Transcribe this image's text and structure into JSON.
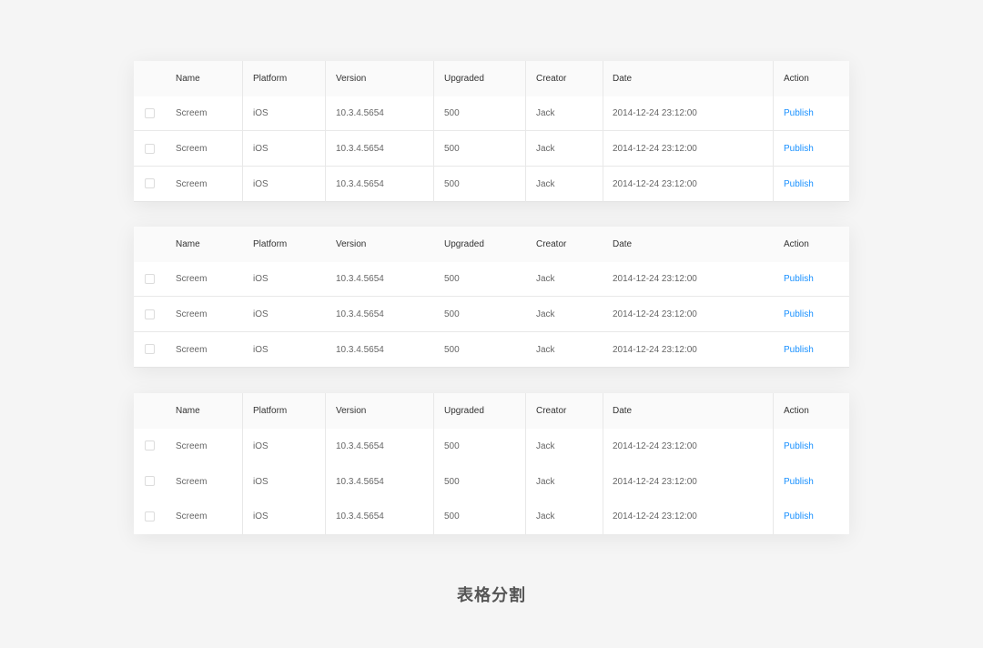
{
  "columns": {
    "name": "Name",
    "platform": "Platform",
    "version": "Version",
    "upgraded": "Upgraded",
    "creator": "Creator",
    "date": "Date",
    "action": "Action"
  },
  "tables": [
    {
      "rows": [
        {
          "name": "Screem",
          "platform": "iOS",
          "version": "10.3.4.5654",
          "upgraded": "500",
          "creator": "Jack",
          "date": "2014-12-24 23:12:00",
          "action": "Publish"
        },
        {
          "name": "Screem",
          "platform": "iOS",
          "version": "10.3.4.5654",
          "upgraded": "500",
          "creator": "Jack",
          "date": "2014-12-24 23:12:00",
          "action": "Publish"
        },
        {
          "name": "Screem",
          "platform": "iOS",
          "version": "10.3.4.5654",
          "upgraded": "500",
          "creator": "Jack",
          "date": "2014-12-24 23:12:00",
          "action": "Publish"
        }
      ]
    },
    {
      "rows": [
        {
          "name": "Screem",
          "platform": "iOS",
          "version": "10.3.4.5654",
          "upgraded": "500",
          "creator": "Jack",
          "date": "2014-12-24 23:12:00",
          "action": "Publish"
        },
        {
          "name": "Screem",
          "platform": "iOS",
          "version": "10.3.4.5654",
          "upgraded": "500",
          "creator": "Jack",
          "date": "2014-12-24 23:12:00",
          "action": "Publish"
        },
        {
          "name": "Screem",
          "platform": "iOS",
          "version": "10.3.4.5654",
          "upgraded": "500",
          "creator": "Jack",
          "date": "2014-12-24 23:12:00",
          "action": "Publish"
        }
      ]
    },
    {
      "rows": [
        {
          "name": "Screem",
          "platform": "iOS",
          "version": "10.3.4.5654",
          "upgraded": "500",
          "creator": "Jack",
          "date": "2014-12-24 23:12:00",
          "action": "Publish"
        },
        {
          "name": "Screem",
          "platform": "iOS",
          "version": "10.3.4.5654",
          "upgraded": "500",
          "creator": "Jack",
          "date": "2014-12-24 23:12:00",
          "action": "Publish"
        },
        {
          "name": "Screem",
          "platform": "iOS",
          "version": "10.3.4.5654",
          "upgraded": "500",
          "creator": "Jack",
          "date": "2014-12-24 23:12:00",
          "action": "Publish"
        }
      ]
    }
  ],
  "caption": "表格分割",
  "colors": {
    "background": "#f5f5f5",
    "header": "#fafafa",
    "link": "#1890ff",
    "divider": "#e8e8e8"
  }
}
